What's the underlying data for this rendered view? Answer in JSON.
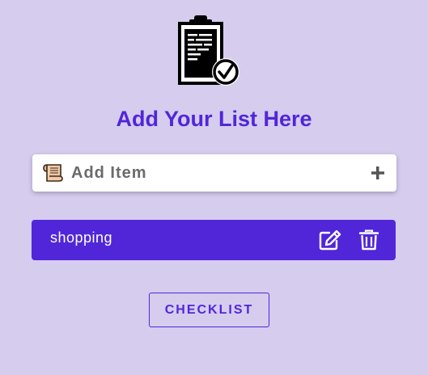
{
  "header": {
    "logo_icon": "clipboard-check-icon",
    "title": "Add Your List Here"
  },
  "add_item": {
    "placeholder": "Add Item",
    "value": "",
    "icon": "scroll-icon",
    "action_icon": "plus-icon"
  },
  "items": [
    {
      "label": "shopping",
      "edit_icon": "edit-icon",
      "delete_icon": "trash-icon"
    }
  ],
  "footer": {
    "checklist_label": "CHECKLIST"
  },
  "colors": {
    "background": "#d5ccee",
    "accent": "#5126d9",
    "white": "#ffffff"
  }
}
